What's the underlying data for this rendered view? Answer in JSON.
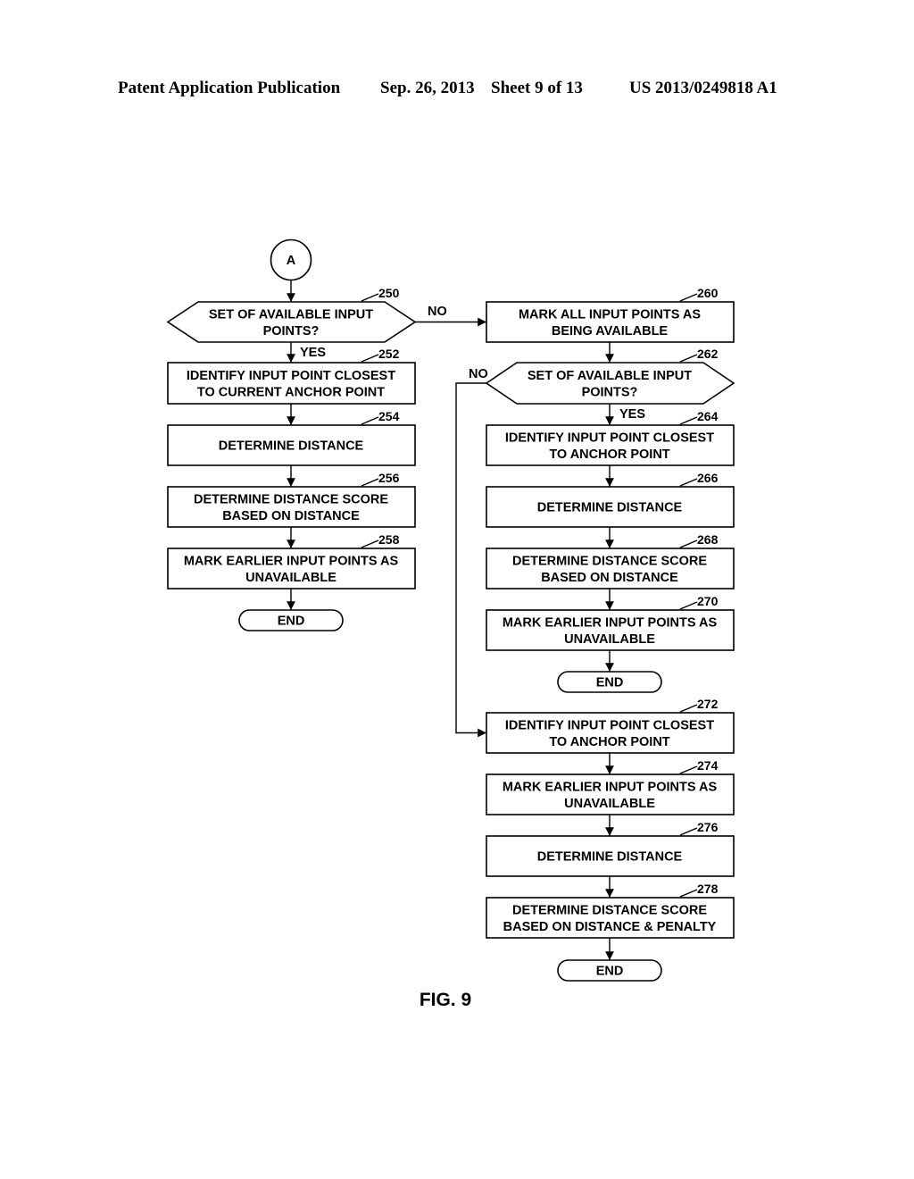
{
  "header": {
    "publication_type": "Patent Application Publication",
    "date": "Sep. 26, 2013",
    "sheet": "Sheet 9 of 13",
    "patent_number": "US 2013/0249818 A1"
  },
  "figure_label": "FIG. 9",
  "connector": {
    "label": "A"
  },
  "branch_labels": {
    "yes": "YES",
    "no": "NO"
  },
  "nodes": {
    "n250": {
      "ref": "250",
      "type": "decision",
      "lines": [
        "SET OF AVAILABLE INPUT",
        "POINTS?"
      ]
    },
    "n252": {
      "ref": "252",
      "type": "process",
      "lines": [
        "IDENTIFY INPUT POINT CLOSEST",
        "TO CURRENT ANCHOR POINT"
      ]
    },
    "n254": {
      "ref": "254",
      "type": "process",
      "lines": [
        "DETERMINE DISTANCE"
      ]
    },
    "n256": {
      "ref": "256",
      "type": "process",
      "lines": [
        "DETERMINE DISTANCE SCORE",
        "BASED ON DISTANCE"
      ]
    },
    "n258": {
      "ref": "258",
      "type": "process",
      "lines": [
        "MARK EARLIER INPUT POINTS AS",
        "UNAVAILABLE"
      ]
    },
    "end1": {
      "type": "terminal",
      "lines": [
        "END"
      ]
    },
    "n260": {
      "ref": "260",
      "type": "process",
      "lines": [
        "MARK ALL INPUT POINTS AS",
        "BEING AVAILABLE"
      ]
    },
    "n262": {
      "ref": "262",
      "type": "decision",
      "lines": [
        "SET OF AVAILABLE INPUT",
        "POINTS?"
      ]
    },
    "n264": {
      "ref": "264",
      "type": "process",
      "lines": [
        "IDENTIFY INPUT POINT CLOSEST",
        "TO ANCHOR POINT"
      ]
    },
    "n266": {
      "ref": "266",
      "type": "process",
      "lines": [
        "DETERMINE DISTANCE"
      ]
    },
    "n268": {
      "ref": "268",
      "type": "process",
      "lines": [
        "DETERMINE DISTANCE SCORE",
        "BASED ON DISTANCE"
      ]
    },
    "n270": {
      "ref": "270",
      "type": "process",
      "lines": [
        "MARK EARLIER INPUT POINTS AS",
        "UNAVAILABLE"
      ]
    },
    "end2": {
      "type": "terminal",
      "lines": [
        "END"
      ]
    },
    "n272": {
      "ref": "272",
      "type": "process",
      "lines": [
        "IDENTIFY INPUT POINT CLOSEST",
        "TO ANCHOR POINT"
      ]
    },
    "n274": {
      "ref": "274",
      "type": "process",
      "lines": [
        "MARK EARLIER INPUT POINTS AS",
        "UNAVAILABLE"
      ]
    },
    "n276": {
      "ref": "276",
      "type": "process",
      "lines": [
        "DETERMINE DISTANCE"
      ]
    },
    "n278": {
      "ref": "278",
      "type": "process",
      "lines": [
        "DETERMINE DISTANCE SCORE",
        "BASED ON DISTANCE & PENALTY"
      ]
    },
    "end3": {
      "type": "terminal",
      "lines": [
        "END"
      ]
    }
  },
  "edges": [
    {
      "from": "connector",
      "to": "n250"
    },
    {
      "from": "n250",
      "to": "n252",
      "label": "YES"
    },
    {
      "from": "n250",
      "to": "n260",
      "label": "NO"
    },
    {
      "from": "n252",
      "to": "n254"
    },
    {
      "from": "n254",
      "to": "n256"
    },
    {
      "from": "n256",
      "to": "n258"
    },
    {
      "from": "n258",
      "to": "end1"
    },
    {
      "from": "n260",
      "to": "n262"
    },
    {
      "from": "n262",
      "to": "n264",
      "label": "YES"
    },
    {
      "from": "n262",
      "to": "n272",
      "label": "NO"
    },
    {
      "from": "n264",
      "to": "n266"
    },
    {
      "from": "n266",
      "to": "n268"
    },
    {
      "from": "n268",
      "to": "n270"
    },
    {
      "from": "n270",
      "to": "end2"
    },
    {
      "from": "n272",
      "to": "n274"
    },
    {
      "from": "n274",
      "to": "n276"
    },
    {
      "from": "n276",
      "to": "n278"
    },
    {
      "from": "n278",
      "to": "end3"
    }
  ]
}
